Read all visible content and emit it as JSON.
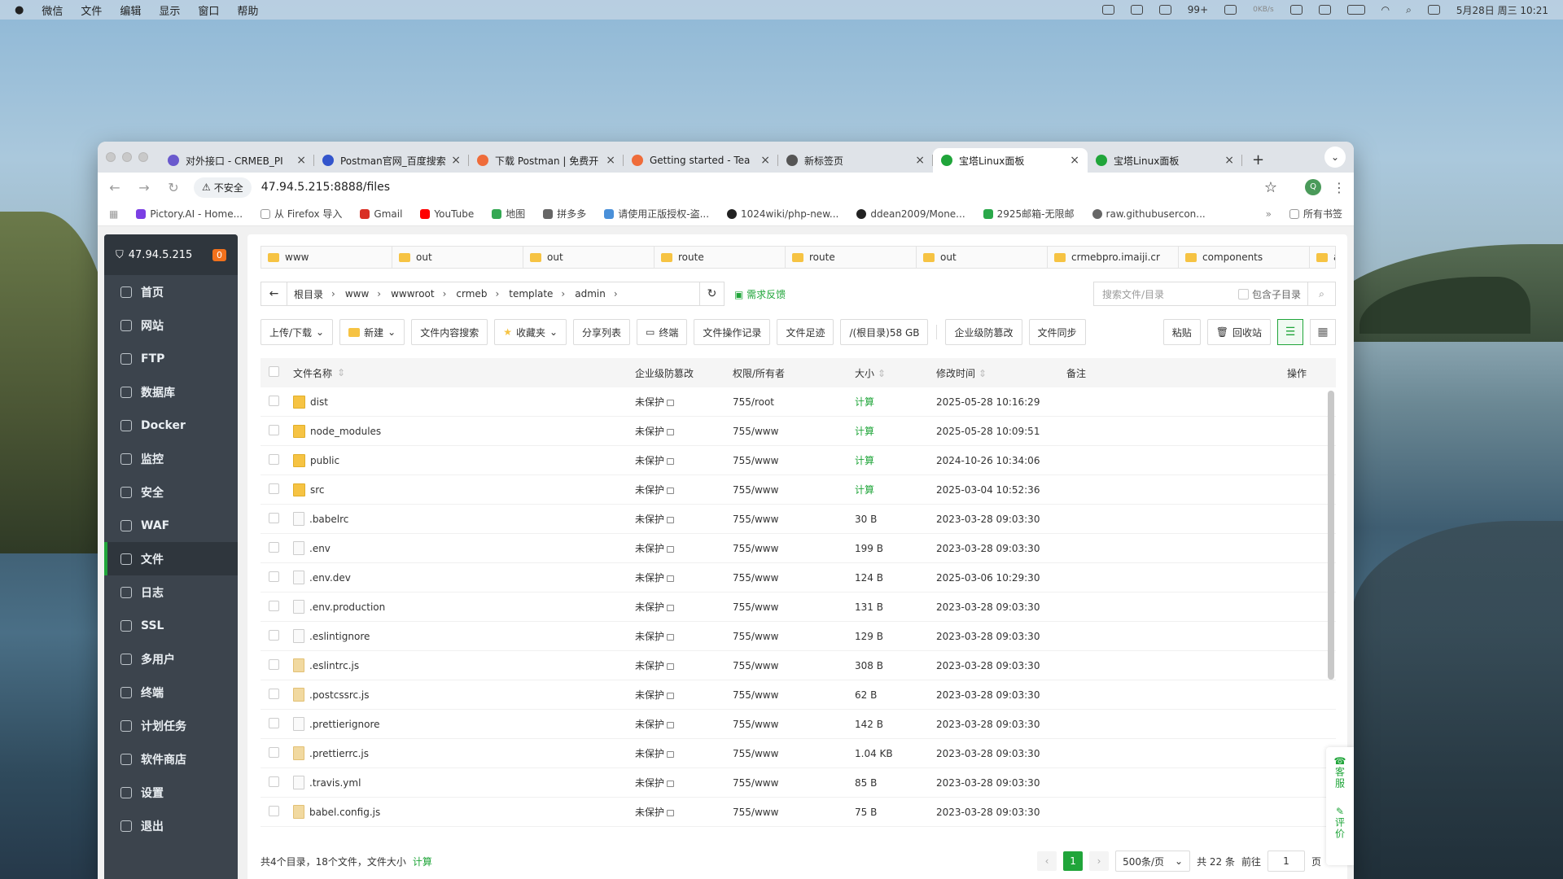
{
  "menubar": {
    "apple": "",
    "items": [
      "微信",
      "文件",
      "编辑",
      "显示",
      "窗口",
      "帮助"
    ],
    "notif_count": "99+",
    "net_speed": "0KB/s",
    "datetime": "5月28日 周三 10:21"
  },
  "browser": {
    "tabs": [
      {
        "title": "对外接口 - CRMEB_PI",
        "color": "#6a5acd"
      },
      {
        "title": "Postman官网_百度搜索",
        "color": "#3355cc"
      },
      {
        "title": "下载 Postman | 免费开",
        "color": "#ef6c3a"
      },
      {
        "title": "Getting started - Tea",
        "color": "#ef6c3a"
      },
      {
        "title": "新标签页",
        "color": "#555"
      },
      {
        "title": "宝塔Linux面板",
        "color": "#20a53a",
        "active": true
      },
      {
        "title": "宝塔Linux面板",
        "color": "#20a53a"
      }
    ],
    "new_tab": "+",
    "insecure_label": "不安全",
    "url": "47.94.5.215:8888/files",
    "avatar_letter": "Q",
    "bookmarks": [
      {
        "label": "Pictory.AI - Home...",
        "color": "#7b3fe4"
      },
      {
        "label": "从 Firefox 导入",
        "color": "#999"
      },
      {
        "label": "Gmail",
        "color": "#d93025"
      },
      {
        "label": "YouTube",
        "color": "#ff0000"
      },
      {
        "label": "地图",
        "color": "#34a853"
      },
      {
        "label": "拼多多",
        "color": "#666"
      },
      {
        "label": "请使用正版授权-盗...",
        "color": "#4a90d9"
      },
      {
        "label": "1024wiki/php-new...",
        "color": "#222"
      },
      {
        "label": "ddean2009/Mone...",
        "color": "#222"
      },
      {
        "label": "2925邮箱-无限邮",
        "color": "#2aa84a"
      },
      {
        "label": "raw.githubusercon...",
        "color": "#666"
      }
    ],
    "bookmarks_more": "»",
    "all_bookmarks": "所有书签"
  },
  "sidebar": {
    "host": "47.94.5.215",
    "badge": "0",
    "items": [
      "首页",
      "网站",
      "FTP",
      "数据库",
      "Docker",
      "监控",
      "安全",
      "WAF",
      "文件",
      "日志",
      "SSL",
      "多用户",
      "终端",
      "计划任务",
      "软件商店",
      "设置",
      "退出"
    ],
    "active": "文件"
  },
  "quick_tabs": [
    "www",
    "out",
    "out",
    "route",
    "route",
    "out",
    "crmebpro.imaiji.cr",
    "components",
    "a"
  ],
  "path": {
    "crumbs": [
      "根目录",
      "www",
      "wwwroot",
      "crmeb",
      "template",
      "admin"
    ],
    "feedback": "需求反馈",
    "search_placeholder": "搜索文件/目录",
    "include_sub": "包含子目录"
  },
  "buttons": {
    "upload": "上传/下载",
    "new": "新建",
    "content_search": "文件内容搜索",
    "favorites": "收藏夹",
    "share_list": "分享列表",
    "terminal": "终端",
    "op_log": "文件操作记录",
    "footprint": "文件足迹",
    "disk": "/(根目录)58 GB",
    "tamper": "企业级防篡改",
    "sync": "文件同步",
    "paste": "粘贴",
    "recycle": "回收站"
  },
  "table": {
    "headers": {
      "name": "文件名称",
      "protect": "企业级防篡改",
      "perm": "权限/所有者",
      "size": "大小",
      "mtime": "修改时间",
      "remark": "备注",
      "ops": "操作"
    },
    "rows": [
      {
        "name": "dist",
        "type": "folder",
        "protect": "未保护",
        "perm": "755/root",
        "size": "计算",
        "mtime": "2025-05-28 10:16:29"
      },
      {
        "name": "node_modules",
        "type": "folder",
        "protect": "未保护",
        "perm": "755/www",
        "size": "计算",
        "mtime": "2025-05-28 10:09:51"
      },
      {
        "name": "public",
        "type": "folder",
        "protect": "未保护",
        "perm": "755/www",
        "size": "计算",
        "mtime": "2024-10-26 10:34:06"
      },
      {
        "name": "src",
        "type": "folder",
        "protect": "未保护",
        "perm": "755/www",
        "size": "计算",
        "mtime": "2025-03-04 10:52:36"
      },
      {
        "name": ".babelrc",
        "type": "file",
        "protect": "未保护",
        "perm": "755/www",
        "size": "30 B",
        "mtime": "2023-03-28 09:03:30"
      },
      {
        "name": ".env",
        "type": "file",
        "protect": "未保护",
        "perm": "755/www",
        "size": "199 B",
        "mtime": "2023-03-28 09:03:30"
      },
      {
        "name": ".env.dev",
        "type": "file",
        "protect": "未保护",
        "perm": "755/www",
        "size": "124 B",
        "mtime": "2025-03-06 10:29:30"
      },
      {
        "name": ".env.production",
        "type": "file",
        "protect": "未保护",
        "perm": "755/www",
        "size": "131 B",
        "mtime": "2023-03-28 09:03:30"
      },
      {
        "name": ".eslintignore",
        "type": "file",
        "protect": "未保护",
        "perm": "755/www",
        "size": "129 B",
        "mtime": "2023-03-28 09:03:30"
      },
      {
        "name": ".eslintrc.js",
        "type": "js",
        "protect": "未保护",
        "perm": "755/www",
        "size": "308 B",
        "mtime": "2023-03-28 09:03:30"
      },
      {
        "name": ".postcssrc.js",
        "type": "js",
        "protect": "未保护",
        "perm": "755/www",
        "size": "62 B",
        "mtime": "2023-03-28 09:03:30"
      },
      {
        "name": ".prettierignore",
        "type": "file",
        "protect": "未保护",
        "perm": "755/www",
        "size": "142 B",
        "mtime": "2023-03-28 09:03:30"
      },
      {
        "name": ".prettierrc.js",
        "type": "js",
        "protect": "未保护",
        "perm": "755/www",
        "size": "1.04 KB",
        "mtime": "2023-03-28 09:03:30"
      },
      {
        "name": ".travis.yml",
        "type": "file",
        "protect": "未保护",
        "perm": "755/www",
        "size": "85 B",
        "mtime": "2023-03-28 09:03:30"
      },
      {
        "name": "babel.config.js",
        "type": "js",
        "protect": "未保护",
        "perm": "755/www",
        "size": "75 B",
        "mtime": "2023-03-28 09:03:30"
      }
    ]
  },
  "footer": {
    "summary": "共4个目录，18个文件，文件大小",
    "calc": "计算",
    "page": "1",
    "per_page": "500条/页",
    "total": "共 22 条",
    "goto": "前往",
    "goto_value": "1",
    "page_suffix": "页"
  },
  "float": {
    "service": "客服",
    "rate": "评价"
  },
  "colors": {
    "accent": "#20a53a",
    "sidebar": "#3c444d",
    "badge": "#f2711c"
  }
}
